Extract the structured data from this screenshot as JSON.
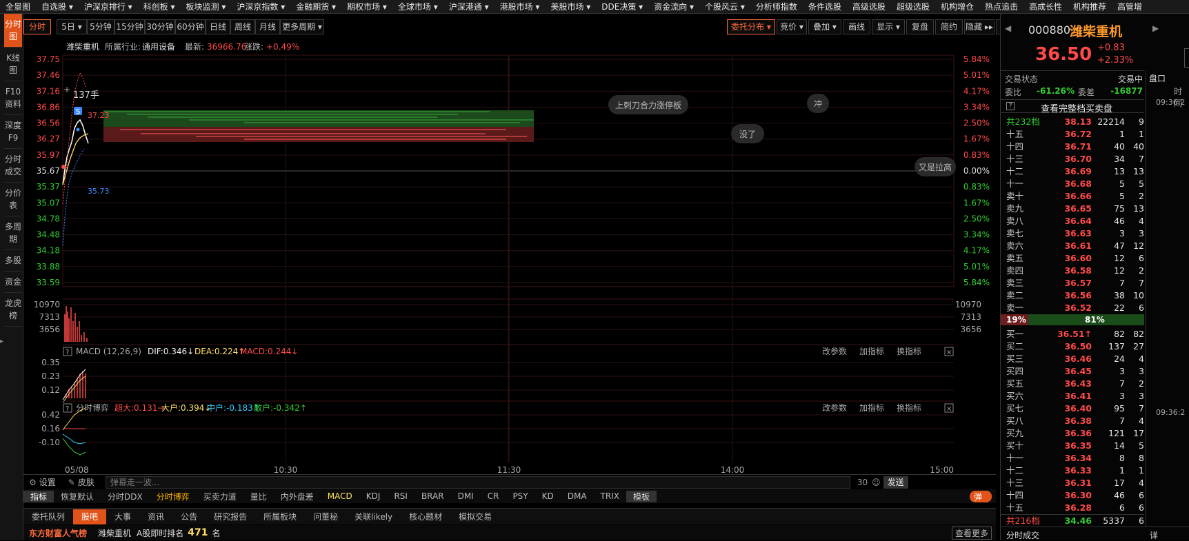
{
  "top_menu": [
    "全景图",
    "自选股 ▾",
    "沪深京排行 ▾",
    "科创板 ▾",
    "板块监测 ▾",
    "沪深京指数 ▾",
    "金融期货 ▾",
    "期权市场 ▾",
    "全球市场 ▾",
    "沪深港通 ▾",
    "港股市场 ▾",
    "美股市场 ▾",
    "DDE决策 ▾",
    "资金流向 ▾",
    "个股风云 ▾",
    "分析师指数",
    "条件选股",
    "高级选股",
    "超级选股",
    "机构增仓",
    "热点追击",
    "高成长性",
    "机构推荐",
    "高管增"
  ],
  "left_nav": [
    "分时图",
    "K线图",
    "F10资料",
    "深度F9",
    "分时成交",
    "分价表",
    "多周期",
    "多股",
    "资金",
    "龙虎榜"
  ],
  "periods": [
    "分时",
    "5日 ▾",
    "5分钟",
    "15分钟",
    "30分钟",
    "60分钟",
    "日线",
    "周线",
    "月线",
    "更多周期 ▾"
  ],
  "chart_tools": [
    "委托分布 ▾",
    "竞价 ▾",
    "叠加 ▾",
    "画线",
    "显示 ▾",
    "复盘",
    "简约",
    "隐藏 ▸▸",
    "⤢"
  ],
  "stock_info": {
    "name": "潍柴重机",
    "industry_label": "所属行业:",
    "industry": "通用设备",
    "latest_label": "最新:",
    "latest": "36966.76",
    "change_label": "涨跌:",
    "change": "+0.49%"
  },
  "price_axis_left": [
    "37.75",
    "37.46",
    "37.16",
    "36.86",
    "36.56",
    "36.27",
    "35.97",
    "35.67",
    "35.37",
    "35.07",
    "34.78",
    "34.48",
    "34.18",
    "33.88",
    "33.59"
  ],
  "price_axis_right": [
    "5.84%",
    "5.01%",
    "4.17%",
    "3.34%",
    "2.50%",
    "1.67%",
    "0.83%",
    "0.00%",
    "0.83%",
    "1.67%",
    "2.50%",
    "3.34%",
    "4.17%",
    "5.01%",
    "5.84%"
  ],
  "volume_axis": [
    "10970",
    "7313",
    "3656"
  ],
  "macd": {
    "title": "MACD (12,26,9)",
    "dif": "DIF:0.346↓",
    "dea": "DEA:0.224↑",
    "macd": "MACD:0.244↓",
    "axis": [
      "0.35",
      "0.23",
      "0.12"
    ]
  },
  "game": {
    "title": "分时博弈",
    "super": "超大:0.131→",
    "big": "大户:0.394↓",
    "mid": "中户:-0.183↑",
    "small": "散户:-0.342↑",
    "axis": [
      "0.42",
      "0.16",
      "-0.10"
    ]
  },
  "panel_actions": [
    "改参数",
    "加指标",
    "换指标"
  ],
  "time_axis": [
    "05/08",
    "10:30",
    "11:30",
    "14:00",
    "15:00"
  ],
  "annotations": {
    "hand": "137手",
    "s_label": "S",
    "high": "37.23",
    "low": "35.73"
  },
  "danmaku": [
    "上刺刀合力涨停板",
    "冲",
    "没了",
    "又是拉高"
  ],
  "bottom_tools": {
    "settings": "设置",
    "skin": "皮肤",
    "input_placeholder": "弹幕走一波...",
    "count": "30",
    "send": "发送"
  },
  "indicators": [
    "指标",
    "恢复默认",
    "分时DDX",
    "分时博弈",
    "买卖力道",
    "量比",
    "内外盘差",
    "MACD",
    "KDJ",
    "RSI",
    "BRAR",
    "DMI",
    "CR",
    "PSY",
    "KD",
    "DMA",
    "TRIX",
    "模板"
  ],
  "danmaku_toggle": "弹",
  "tabs": [
    "委托队列",
    "股吧",
    "大事",
    "资讯",
    "公告",
    "研究报告",
    "所属板块",
    "问董秘",
    "关联likely",
    "核心题材",
    "模拟交易"
  ],
  "rank": {
    "logo": "东方财富人气榜",
    "stock": "潍柴重机",
    "label": "A股即时排名",
    "value": "471",
    "unit": "名",
    "more": "查看更多"
  },
  "quote": {
    "code": "000880",
    "name": "潍柴重机",
    "price": "36.50",
    "change": "+0.83",
    "pct": "+2.33%",
    "status_label": "交易状态",
    "status": "交易中",
    "ratio_label": "委比",
    "ratio": "-61.26%",
    "diff_label": "委差",
    "diff": "-16877",
    "full_book": "查看完整档买卖盘",
    "sell_total_label": "共232档",
    "sell_total_price": "38.13",
    "sell_total_vol": "22214",
    "sell_total_cnt": "9",
    "buy_total_label": "共216档",
    "buy_total_price": "34.46",
    "buy_total_vol": "5337",
    "buy_total_cnt": "6",
    "sell_pct": "19%",
    "buy_pct": "81%",
    "foot": "分时成交",
    "foot_btn": "详"
  },
  "asks": [
    {
      "l": "十五",
      "p": "36.72",
      "v": "1",
      "c": "1"
    },
    {
      "l": "十四",
      "p": "36.71",
      "v": "40",
      "c": "40"
    },
    {
      "l": "十三",
      "p": "36.70",
      "v": "34",
      "c": "7"
    },
    {
      "l": "十二",
      "p": "36.69",
      "v": "13",
      "c": "13"
    },
    {
      "l": "十一",
      "p": "36.68",
      "v": "5",
      "c": "5"
    },
    {
      "l": "卖十",
      "p": "36.66",
      "v": "5",
      "c": "2"
    },
    {
      "l": "卖九",
      "p": "36.65",
      "v": "75",
      "c": "13"
    },
    {
      "l": "卖八",
      "p": "36.64",
      "v": "46",
      "c": "4"
    },
    {
      "l": "卖七",
      "p": "36.63",
      "v": "3",
      "c": "3"
    },
    {
      "l": "卖六",
      "p": "36.61",
      "v": "47",
      "c": "12"
    },
    {
      "l": "卖五",
      "p": "36.60",
      "v": "12",
      "c": "6"
    },
    {
      "l": "卖四",
      "p": "36.58",
      "v": "12",
      "c": "2"
    },
    {
      "l": "卖三",
      "p": "36.57",
      "v": "7",
      "c": "7"
    },
    {
      "l": "卖二",
      "p": "36.56",
      "v": "38",
      "c": "10"
    },
    {
      "l": "卖一",
      "p": "36.52",
      "v": "22",
      "c": "6"
    }
  ],
  "bids": [
    {
      "l": "买一",
      "p": "36.51↑",
      "v": "82",
      "c": "82"
    },
    {
      "l": "买二",
      "p": "36.50",
      "v": "137",
      "c": "27"
    },
    {
      "l": "买三",
      "p": "36.46",
      "v": "24",
      "c": "4"
    },
    {
      "l": "买四",
      "p": "36.45",
      "v": "3",
      "c": "3"
    },
    {
      "l": "买五",
      "p": "36.43",
      "v": "7",
      "c": "2"
    },
    {
      "l": "买六",
      "p": "36.41",
      "v": "3",
      "c": "3"
    },
    {
      "l": "买七",
      "p": "36.40",
      "v": "95",
      "c": "7"
    },
    {
      "l": "买八",
      "p": "36.38",
      "v": "7",
      "c": "4"
    },
    {
      "l": "买九",
      "p": "36.36",
      "v": "121",
      "c": "17"
    },
    {
      "l": "买十",
      "p": "36.35",
      "v": "14",
      "c": "5"
    },
    {
      "l": "十一",
      "p": "36.34",
      "v": "8",
      "c": "8"
    },
    {
      "l": "十二",
      "p": "36.33",
      "v": "1",
      "c": "1"
    },
    {
      "l": "十三",
      "p": "36.31",
      "v": "17",
      "c": "4"
    },
    {
      "l": "十四",
      "p": "36.30",
      "v": "46",
      "c": "6"
    },
    {
      "l": "十五",
      "p": "36.28",
      "v": "6",
      "c": "6"
    }
  ],
  "side_tabs": {
    "pankou": "盘口",
    "time": "时间",
    "t1": "09:36:2",
    "t2": "09:36:2"
  },
  "colors": {
    "accent": "#e0531a",
    "up": "#ff4a4a",
    "down": "#33cc33",
    "gold": "#ffb400"
  }
}
